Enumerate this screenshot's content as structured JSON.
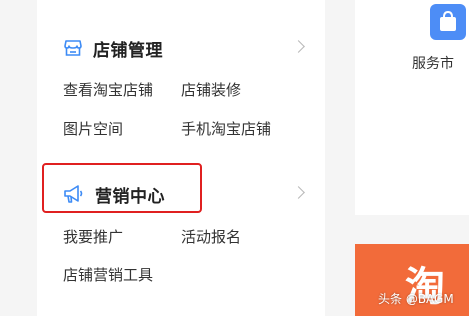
{
  "sidebar": {
    "store_section": {
      "title": "店铺管理",
      "links": [
        "查看淘宝店铺",
        "店铺装修",
        "图片空间",
        "手机淘宝店铺"
      ]
    },
    "marketing_section": {
      "title": "营销中心",
      "links": [
        "我要推广",
        "活动报名",
        "店铺营销工具"
      ]
    }
  },
  "right_panel": {
    "service_label": "服务市",
    "banner_text": "淘"
  },
  "watermark": "头条 @BAGM",
  "colors": {
    "accent": "#4d8df6",
    "highlight": "#e02020",
    "banner": "#f26b3a"
  }
}
